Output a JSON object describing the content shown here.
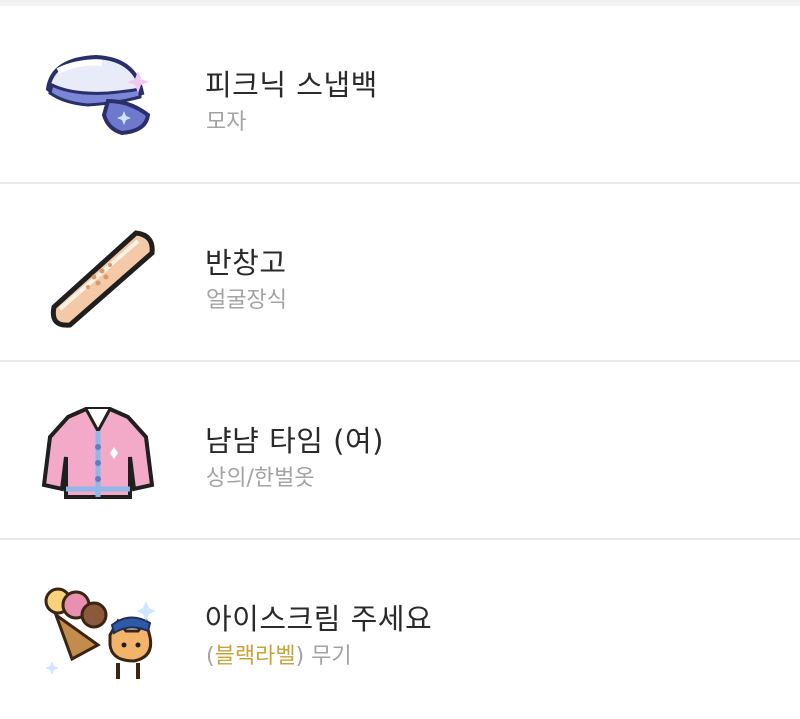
{
  "items": [
    {
      "name": "피크닉 스냅백",
      "category": "모자",
      "icon": "picnic-snapback-cap-icon"
    },
    {
      "name": "반창고",
      "category": "얼굴장식",
      "icon": "bandage-icon"
    },
    {
      "name": "냠냠 타임 (여)",
      "category": "상의/한벌옷",
      "icon": "pink-jacket-icon"
    },
    {
      "name": "아이스크림 주세요",
      "label_open": "(",
      "label_text": "블랙라벨",
      "label_close": ")",
      "category": "무기",
      "icon": "ice-cream-weapon-icon"
    }
  ],
  "colors": {
    "label_gold": "#c9a33a",
    "category_gray": "#a3a3a3",
    "divider": "#e9e9e9"
  }
}
